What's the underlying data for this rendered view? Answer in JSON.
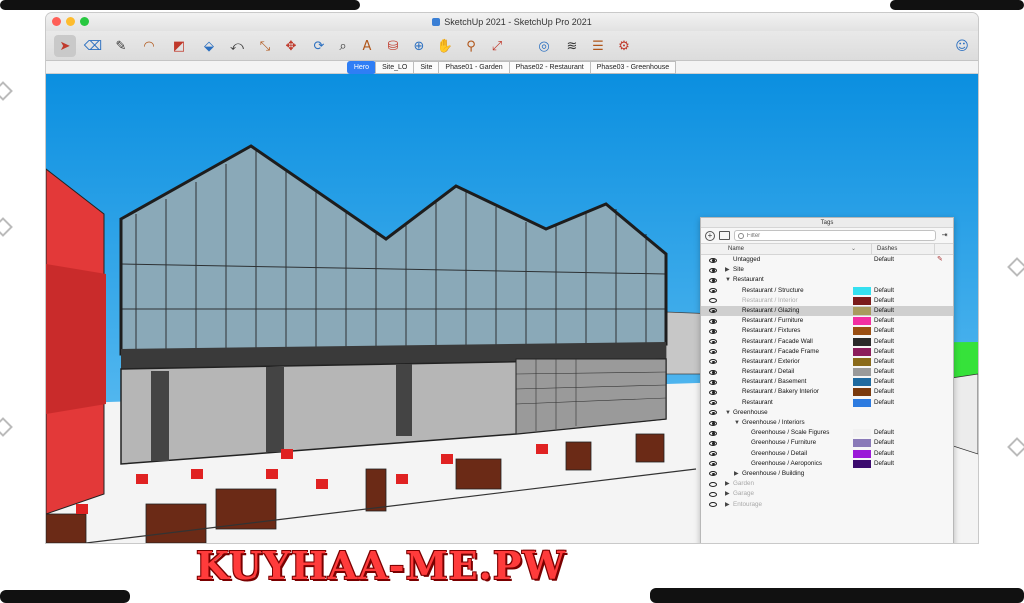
{
  "window": {
    "title": "SketchUp 2021 - SketchUp Pro 2021"
  },
  "toolbar": {
    "tools": [
      {
        "name": "select-tool-icon",
        "glyph": "➤"
      },
      {
        "name": "eraser-tool-icon",
        "glyph": "⌫"
      },
      {
        "name": "line-tool-icon",
        "glyph": "✎"
      },
      {
        "name": "arc-tool-icon",
        "glyph": "◠"
      },
      {
        "name": "rectangle-tool-icon",
        "glyph": "◩"
      },
      {
        "name": "push-pull-icon",
        "glyph": "⬙"
      },
      {
        "name": "offset-icon",
        "glyph": "⤺"
      },
      {
        "name": "scale-icon",
        "glyph": "⤡"
      },
      {
        "name": "move-icon",
        "glyph": "✥"
      },
      {
        "name": "rotate-icon",
        "glyph": "⟳"
      },
      {
        "name": "tape-measure-icon",
        "glyph": "⌕"
      },
      {
        "name": "text-icon",
        "glyph": "A"
      },
      {
        "name": "paint-bucket-icon",
        "glyph": "⛁"
      },
      {
        "name": "orbit-icon",
        "glyph": "⊕"
      },
      {
        "name": "pan-icon",
        "glyph": "✋"
      },
      {
        "name": "zoom-icon",
        "glyph": "⚲"
      },
      {
        "name": "zoom-extents-icon",
        "glyph": "⤢"
      },
      {
        "name": "warehouse-icon",
        "glyph": "◎"
      },
      {
        "name": "extension-warehouse-icon",
        "glyph": "≋"
      },
      {
        "name": "layers-icon",
        "glyph": "☰"
      },
      {
        "name": "extensions-icon",
        "glyph": "⚙"
      },
      {
        "name": "account-icon",
        "glyph": "☺"
      }
    ]
  },
  "scenes": [
    "Hero",
    "Site_LO",
    "Site",
    "Phase01 - Garden",
    "Phase02 - Restaurant",
    "Phase03 - Greenhouse"
  ],
  "active_scene": "Hero",
  "tags_panel": {
    "title": "Tags",
    "filter_placeholder": "Filter",
    "col_name": "Name",
    "col_dashes": "Dashes",
    "rows": [
      {
        "name": "Untagged",
        "visible": true,
        "indent": 0,
        "arrow": "",
        "color": "",
        "dash": "Default",
        "pencil": true
      },
      {
        "name": "Site",
        "visible": true,
        "indent": 0,
        "arrow": "▶",
        "color": "",
        "dash": ""
      },
      {
        "name": "Restaurant",
        "visible": true,
        "indent": 0,
        "arrow": "▼",
        "color": "",
        "dash": ""
      },
      {
        "name": "Restaurant / Structure",
        "visible": true,
        "indent": 1,
        "arrow": "",
        "color": "#35e0f0",
        "dash": "Default"
      },
      {
        "name": "Restaurant / Interior",
        "visible": false,
        "indent": 1,
        "arrow": "",
        "color": "#7a1b1b",
        "dash": "Default",
        "dim": true
      },
      {
        "name": "Restaurant / Glazing",
        "visible": true,
        "indent": 1,
        "arrow": "",
        "color": "#a89a5e",
        "dash": "Default",
        "selected": true
      },
      {
        "name": "Restaurant / Furniture",
        "visible": true,
        "indent": 1,
        "arrow": "",
        "color": "#f22fa2",
        "dash": "Default"
      },
      {
        "name": "Restaurant / Fixtures",
        "visible": true,
        "indent": 1,
        "arrow": "",
        "color": "#9a4f13",
        "dash": "Default"
      },
      {
        "name": "Restaurant / Facade Wall",
        "visible": true,
        "indent": 1,
        "arrow": "",
        "color": "#2a2a2a",
        "dash": "Default"
      },
      {
        "name": "Restaurant / Facade Frame",
        "visible": true,
        "indent": 1,
        "arrow": "",
        "color": "#8c1d5c",
        "dash": "Default"
      },
      {
        "name": "Restaurant / Exterior",
        "visible": true,
        "indent": 1,
        "arrow": "",
        "color": "#8a6a1a",
        "dash": "Default"
      },
      {
        "name": "Restaurant / Detail",
        "visible": true,
        "indent": 1,
        "arrow": "",
        "color": "#9a9a9a",
        "dash": "Default"
      },
      {
        "name": "Restaurant / Basement",
        "visible": true,
        "indent": 1,
        "arrow": "",
        "color": "#1f6aa0",
        "dash": "Default"
      },
      {
        "name": "Restaurant / Bakery Interior",
        "visible": true,
        "indent": 1,
        "arrow": "",
        "color": "#7a3a0e",
        "dash": "Default"
      },
      {
        "name": "Restaurant",
        "visible": true,
        "indent": 1,
        "arrow": "",
        "color": "#2d7be0",
        "dash": "Default"
      },
      {
        "name": "Greenhouse",
        "visible": true,
        "indent": 0,
        "arrow": "▼",
        "color": "",
        "dash": ""
      },
      {
        "name": "Greenhouse / Interiors",
        "visible": true,
        "indent": 1,
        "arrow": "▼",
        "color": "",
        "dash": ""
      },
      {
        "name": "Greenhouse / Scale Figures",
        "visible": true,
        "indent": 2,
        "arrow": "",
        "color": "#f2f2f2",
        "dash": "Default"
      },
      {
        "name": "Greenhouse / Furniture",
        "visible": true,
        "indent": 2,
        "arrow": "",
        "color": "#8a7ab8",
        "dash": "Default"
      },
      {
        "name": "Greenhouse / Detail",
        "visible": true,
        "indent": 2,
        "arrow": "",
        "color": "#9b1ad8",
        "dash": "Default"
      },
      {
        "name": "Greenhouse / Aeroponics",
        "visible": true,
        "indent": 2,
        "arrow": "",
        "color": "#3b0a6e",
        "dash": "Default"
      },
      {
        "name": "Greenhouse / Building",
        "visible": true,
        "indent": 1,
        "arrow": "▶",
        "color": "",
        "dash": ""
      },
      {
        "name": "Garden",
        "visible": false,
        "indent": 0,
        "arrow": "▶",
        "color": "",
        "dash": "",
        "dim": true
      },
      {
        "name": "Garage",
        "visible": false,
        "indent": 0,
        "arrow": "▶",
        "color": "",
        "dash": "",
        "dim": true
      },
      {
        "name": "Entourage",
        "visible": false,
        "indent": 0,
        "arrow": "▶",
        "color": "",
        "dash": "",
        "dim": true
      }
    ]
  },
  "watermark": "KUYHAA-ME.PW"
}
